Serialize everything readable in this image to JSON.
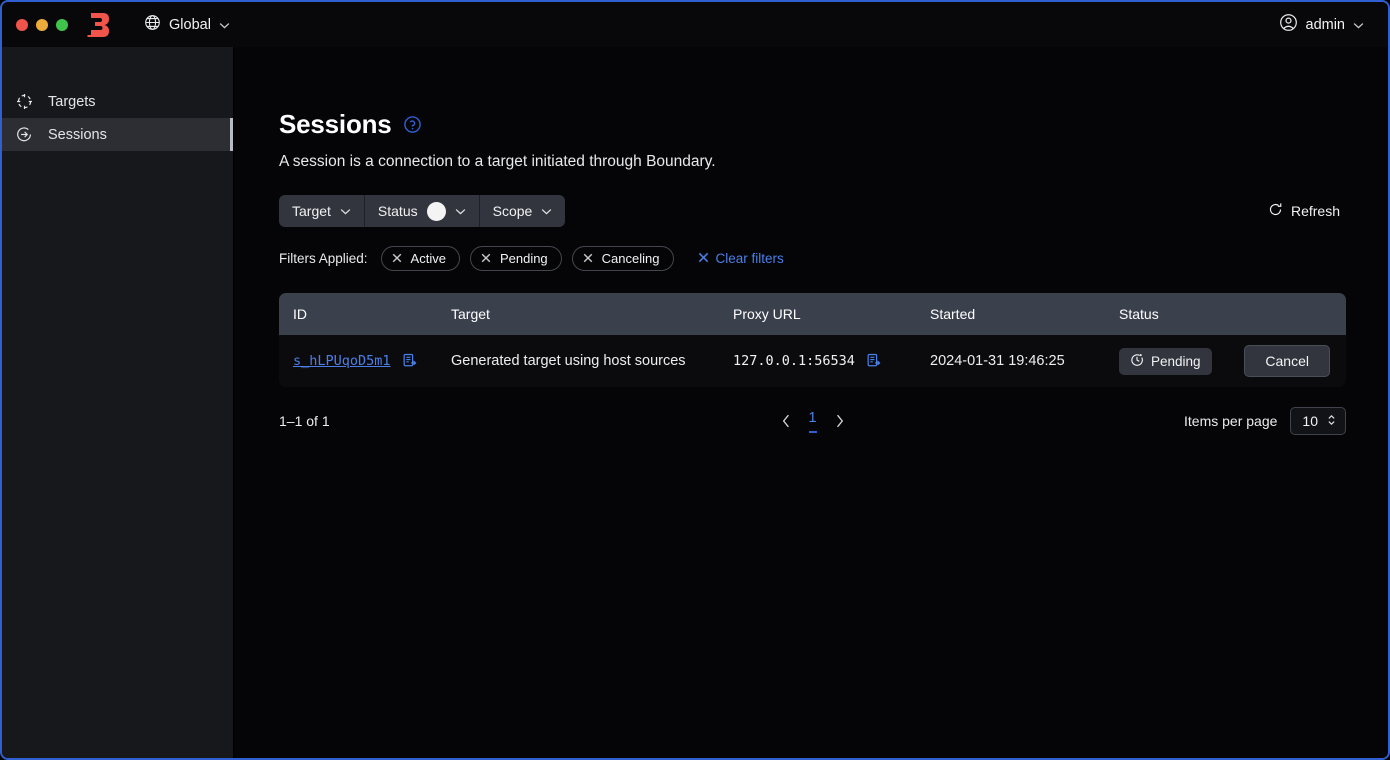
{
  "topbar": {
    "scope_label": "Global",
    "scope_icon": "globe-icon",
    "user_label": "admin",
    "user_icon": "user-circle-icon",
    "logo_name": "boundary-logo",
    "logo_color": "#f0544a"
  },
  "sidebar": {
    "items": [
      {
        "label": "Targets",
        "icon": "target-icon",
        "active": false
      },
      {
        "label": "Sessions",
        "icon": "session-arrow-icon",
        "active": true
      }
    ]
  },
  "page": {
    "title": "Sessions",
    "help_icon": "help-circle-icon",
    "description": "A session is a connection to a target initiated through Boundary."
  },
  "toolbar": {
    "filters": [
      {
        "label": "Target",
        "has_badge": false
      },
      {
        "label": "Status",
        "has_badge": true
      },
      {
        "label": "Scope",
        "has_badge": false
      }
    ],
    "refresh_label": "Refresh",
    "refresh_icon": "refresh-icon"
  },
  "applied_filters": {
    "label": "Filters Applied:",
    "chips": [
      "Active",
      "Pending",
      "Canceling"
    ],
    "clear_label": "Clear filters",
    "clear_icon": "x-icon",
    "clear_color": "#4b7fe8"
  },
  "table": {
    "columns": [
      "ID",
      "Target",
      "Proxy URL",
      "Started",
      "Status"
    ],
    "rows": [
      {
        "id": "s_hLPUqoD5m1",
        "id_copy_icon": "copy-icon",
        "target": "Generated target using host sources",
        "proxy_url": "127.0.0.1:56534",
        "proxy_copy_icon": "copy-icon",
        "started": "2024-01-31 19:46:25",
        "status": "Pending",
        "status_icon": "clock-icon",
        "action_label": "Cancel"
      }
    ]
  },
  "pagination": {
    "summary": "1–1 of 1",
    "prev_icon": "chevron-left-icon",
    "next_icon": "chevron-right-icon",
    "current_page": "1",
    "items_per_page_label": "Items per page",
    "items_per_page_value": "10"
  }
}
